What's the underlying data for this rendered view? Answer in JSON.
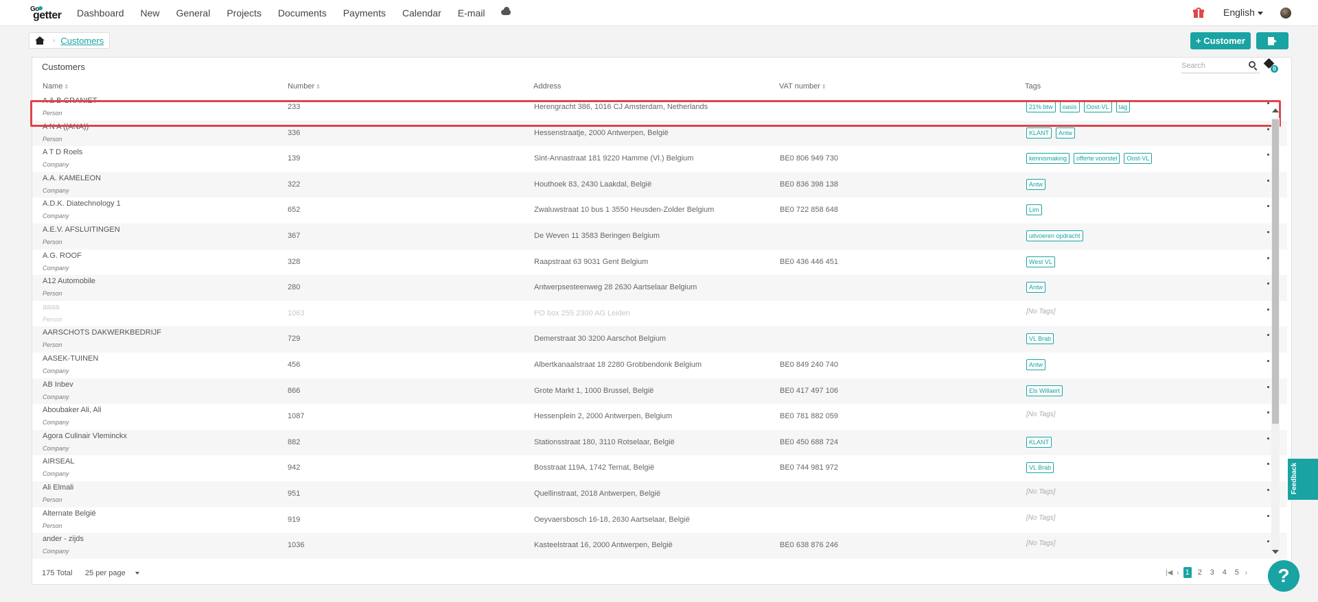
{
  "nav": {
    "logo_top": "Go",
    "logo_bottom": "getter",
    "items": [
      "Dashboard",
      "New",
      "General",
      "Projects",
      "Documents",
      "Payments",
      "Calendar",
      "E-mail"
    ],
    "language": "English"
  },
  "breadcrumb": {
    "current": "Customers"
  },
  "actions": {
    "add_customer": "+ Customer"
  },
  "panel": {
    "title": "Customers",
    "search_placeholder": "Search",
    "tag_filter_count": "0",
    "columns": {
      "name": "Name",
      "number": "Number",
      "address": "Address",
      "vat": "VAT number",
      "tags": "Tags"
    }
  },
  "rows": [
    {
      "name": "A & B GRANIET",
      "type": "Person",
      "number": "233",
      "address": "Herengracht 386, 1016 CJ Amsterdam, Netherlands",
      "vat": "",
      "tags": [
        "21% btw",
        "oasis",
        "Oost-VL",
        "tag"
      ]
    },
    {
      "name": "A N A ((ANA))",
      "type": "Person",
      "number": "336",
      "address": "Hessenstraatje, 2000 Antwerpen, België",
      "vat": "",
      "tags": [
        "KLANT",
        "Antw"
      ]
    },
    {
      "name": "A T D Roels",
      "type": "Company",
      "number": "139",
      "address": "Sint-Annastraat 181 9220 Hamme (Vl.) Belgium",
      "vat": "BE0 806 949 730",
      "tags": [
        "kennismaking",
        "offerte voorstel",
        "Oost-VL"
      ]
    },
    {
      "name": "A.A. KAMELEON",
      "type": "Company",
      "number": "322",
      "address": "Houthoek 83, 2430 Laakdal, België",
      "vat": "BE0 836 398 138",
      "tags": [
        "Antw"
      ]
    },
    {
      "name": "A.D.K. Diatechnology 1",
      "type": "Company",
      "number": "652",
      "address": "Zwaluwstraat 10 bus 1 3550 Heusden-Zolder Belgium",
      "vat": "BE0 722 858 648",
      "tags": [
        "Lim"
      ]
    },
    {
      "name": "A.E.V. AFSLUITINGEN",
      "type": "Person",
      "number": "367",
      "address": "De Weven 11 3583 Beringen Belgium",
      "vat": "",
      "tags": [
        "uitvoeren opdracht"
      ]
    },
    {
      "name": "A.G. ROOF",
      "type": "Company",
      "number": "328",
      "address": "Raapstraat 63 9031 Gent Belgium",
      "vat": "BE0 436 446 451",
      "tags": [
        "West VL"
      ]
    },
    {
      "name": "A12 Automobile",
      "type": "Person",
      "number": "280",
      "address": "Antwerpsesteenweg 28 2630 Aartselaar Belgium",
      "vat": "",
      "tags": [
        "Antw"
      ]
    },
    {
      "name": "aaaa",
      "type": "Person",
      "number": "1063",
      "address": "PO box 255 2300 AG Leiden",
      "vat": "",
      "tags": [],
      "inactive": true
    },
    {
      "name": "AARSCHOTS DAKWERKBEDRIJF",
      "type": "Person",
      "number": "729",
      "address": "Demerstraat 30 3200 Aarschot Belgium",
      "vat": "",
      "tags": [
        "VL Brab"
      ]
    },
    {
      "name": "AASEK-TUINEN",
      "type": "Company",
      "number": "456",
      "address": "Albertkanaalstraat 18 2280 Grobbendonk Belgium",
      "vat": "BE0 849 240 740",
      "tags": [
        "Antw"
      ]
    },
    {
      "name": "AB Inbev",
      "type": "Company",
      "number": "866",
      "address": "Grote Markt 1, 1000 Brussel, België",
      "vat": "BE0 417 497 106",
      "tags": [
        "Els Willaert"
      ]
    },
    {
      "name": "Aboubaker Ali, Ali",
      "type": "Company",
      "number": "1087",
      "address": "Hessenplein 2, 2000 Antwerpen, Belgium",
      "vat": "BE0 781 882 059",
      "tags": []
    },
    {
      "name": "Agora Culinair Vleminckx",
      "type": "Company",
      "number": "882",
      "address": "Stationsstraat 180, 3110 Rotselaar, België",
      "vat": "BE0 450 688 724",
      "tags": [
        "KLANT"
      ]
    },
    {
      "name": "AIRSEAL",
      "type": "Company",
      "number": "942",
      "address": "Bosstraat 119A, 1742 Ternat, België",
      "vat": "BE0 744 981 972",
      "tags": [
        "VL Brab"
      ]
    },
    {
      "name": "Ali Elmali",
      "type": "Person",
      "number": "951",
      "address": "Quellinstraat, 2018 Antwerpen, België",
      "vat": "",
      "tags": []
    },
    {
      "name": "Alternate België",
      "type": "Person",
      "number": "919",
      "address": "Oeyvaersbosch 16-18, 2630 Aartselaar, België",
      "vat": "",
      "tags": []
    },
    {
      "name": "ander - zijds",
      "type": "Company",
      "number": "1036",
      "address": "Kasteelstraat 16, 2000 Antwerpen, België",
      "vat": "BE0 638 876 246",
      "tags": []
    }
  ],
  "no_tags_label": "[No Tags]",
  "footer": {
    "total": "175 Total",
    "per_page": "25 per page",
    "pages": [
      "1",
      "2",
      "3",
      "4",
      "5"
    ],
    "current_page": "1"
  },
  "feedback_label": "Feedback",
  "help_label": "?",
  "colors": {
    "accent": "#1aa3a3",
    "highlight": "#e0434a"
  }
}
